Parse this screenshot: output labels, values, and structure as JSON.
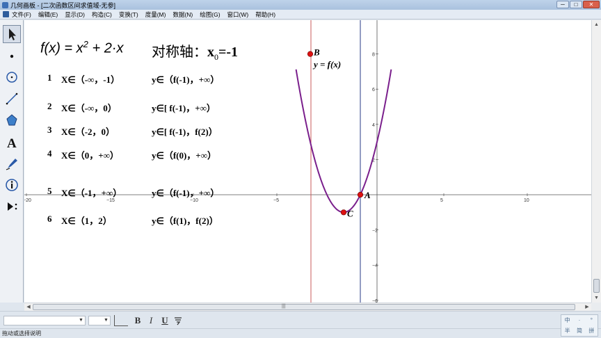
{
  "window": {
    "title": "几何画板 - [二次函数区间求值域-无参]",
    "controls": [
      "─",
      "□",
      "✕"
    ]
  },
  "menu": {
    "items": [
      "文件(F)",
      "编辑(E)",
      "显示(D)",
      "构造(C)",
      "变换(T)",
      "度量(M)",
      "数据(N)",
      "绘图(G)",
      "窗口(W)",
      "帮助(H)"
    ]
  },
  "tools": [
    "arrow-select",
    "point",
    "compass-circle",
    "straightedge-line",
    "polygon",
    "text",
    "marker",
    "information",
    "custom-tools"
  ],
  "canvas": {
    "function_label": {
      "prefix": "f(x) = x",
      "exp": "2",
      "rest": " + 2·x"
    },
    "axis_label": {
      "text": "对称轴：",
      "var": "x",
      "sub": "0",
      "val": "=-1"
    },
    "graph_label": "y = f(x)",
    "rows": [
      {
        "num": "1",
        "x": "X∈（-∞，-1）",
        "y": "y∈（f(-1)，+∞）"
      },
      {
        "num": "2",
        "x": "X∈（-∞，0）",
        "y": "y∈[ f(-1)，+∞）"
      },
      {
        "num": "3",
        "x": "X∈（-2，0）",
        "y": "y∈[ f(-1)，f(2)）"
      },
      {
        "num": "4",
        "x": "X∈（0，+∞）",
        "y": "y∈（f(0)，+∞）"
      },
      {
        "num": "5",
        "x": "X∈（-1，+∞）",
        "y": "y∈（f(-1)，+∞）"
      },
      {
        "num": "6",
        "x": "X∈（1，2）",
        "y": "y∈（f(1)，f(2)）"
      }
    ],
    "points": [
      {
        "label": "A",
        "x": 0,
        "y": 0
      },
      {
        "label": "B",
        "x": -3,
        "y": 8
      },
      {
        "label": "C",
        "x": -1,
        "y": -1
      }
    ],
    "x_ticks": [
      "−20",
      "−15",
      "−10",
      "−5",
      "5",
      "10"
    ],
    "y_ticks": [
      "8",
      "6",
      "4",
      "2",
      "−2",
      "−4",
      "−6"
    ],
    "colors": {
      "curve": "#7a1f8c",
      "vline": "#c85a5a",
      "axis_of_symmetry": "#4b5a9a",
      "point": "#dd1111"
    }
  },
  "format_bar": {
    "bold": "B",
    "italic": "I",
    "underline": "U"
  },
  "status": "拖动或选择说明",
  "ime": [
    "中",
    "·",
    "°",
    "半",
    "简",
    "拼"
  ]
}
